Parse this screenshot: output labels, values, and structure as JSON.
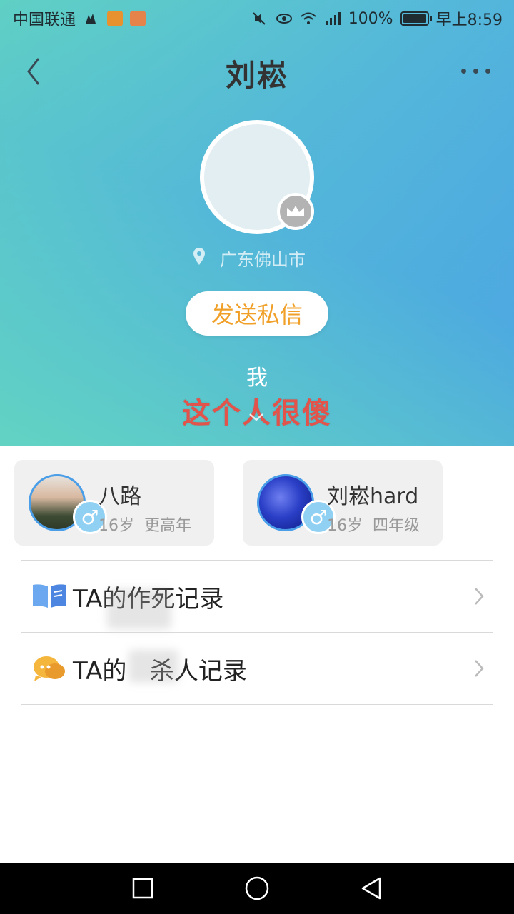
{
  "status_bar": {
    "carrier": "中国联通",
    "battery": "100%",
    "battery_level": 1.0,
    "time": "早上8:59"
  },
  "nav": {
    "title": "刘崧"
  },
  "profile": {
    "location": "广东佛山市",
    "send_message_label": "发送私信",
    "bio_line1": "我",
    "bio_line2": "这个人很傻"
  },
  "cards": [
    {
      "name": "八路",
      "age": "16岁",
      "grade": "更高年",
      "gender_symbol": "♂"
    },
    {
      "name": "刘崧hard",
      "age": "16岁",
      "grade": "四年级",
      "gender_symbol": "♂"
    }
  ],
  "menu": [
    {
      "prefix": "TA的",
      "label": "作死记录",
      "icon": "book-icon"
    },
    {
      "prefix": "TA的",
      "label": "杀人记录",
      "icon": "chat-bubble-icon"
    }
  ],
  "colors": {
    "accent_orange": "#f0a028",
    "bio_red": "#e2544b",
    "gradient_start": "#63d6c0",
    "gradient_end": "#4a9ee8",
    "gender_blue": "#8fd0f3"
  }
}
